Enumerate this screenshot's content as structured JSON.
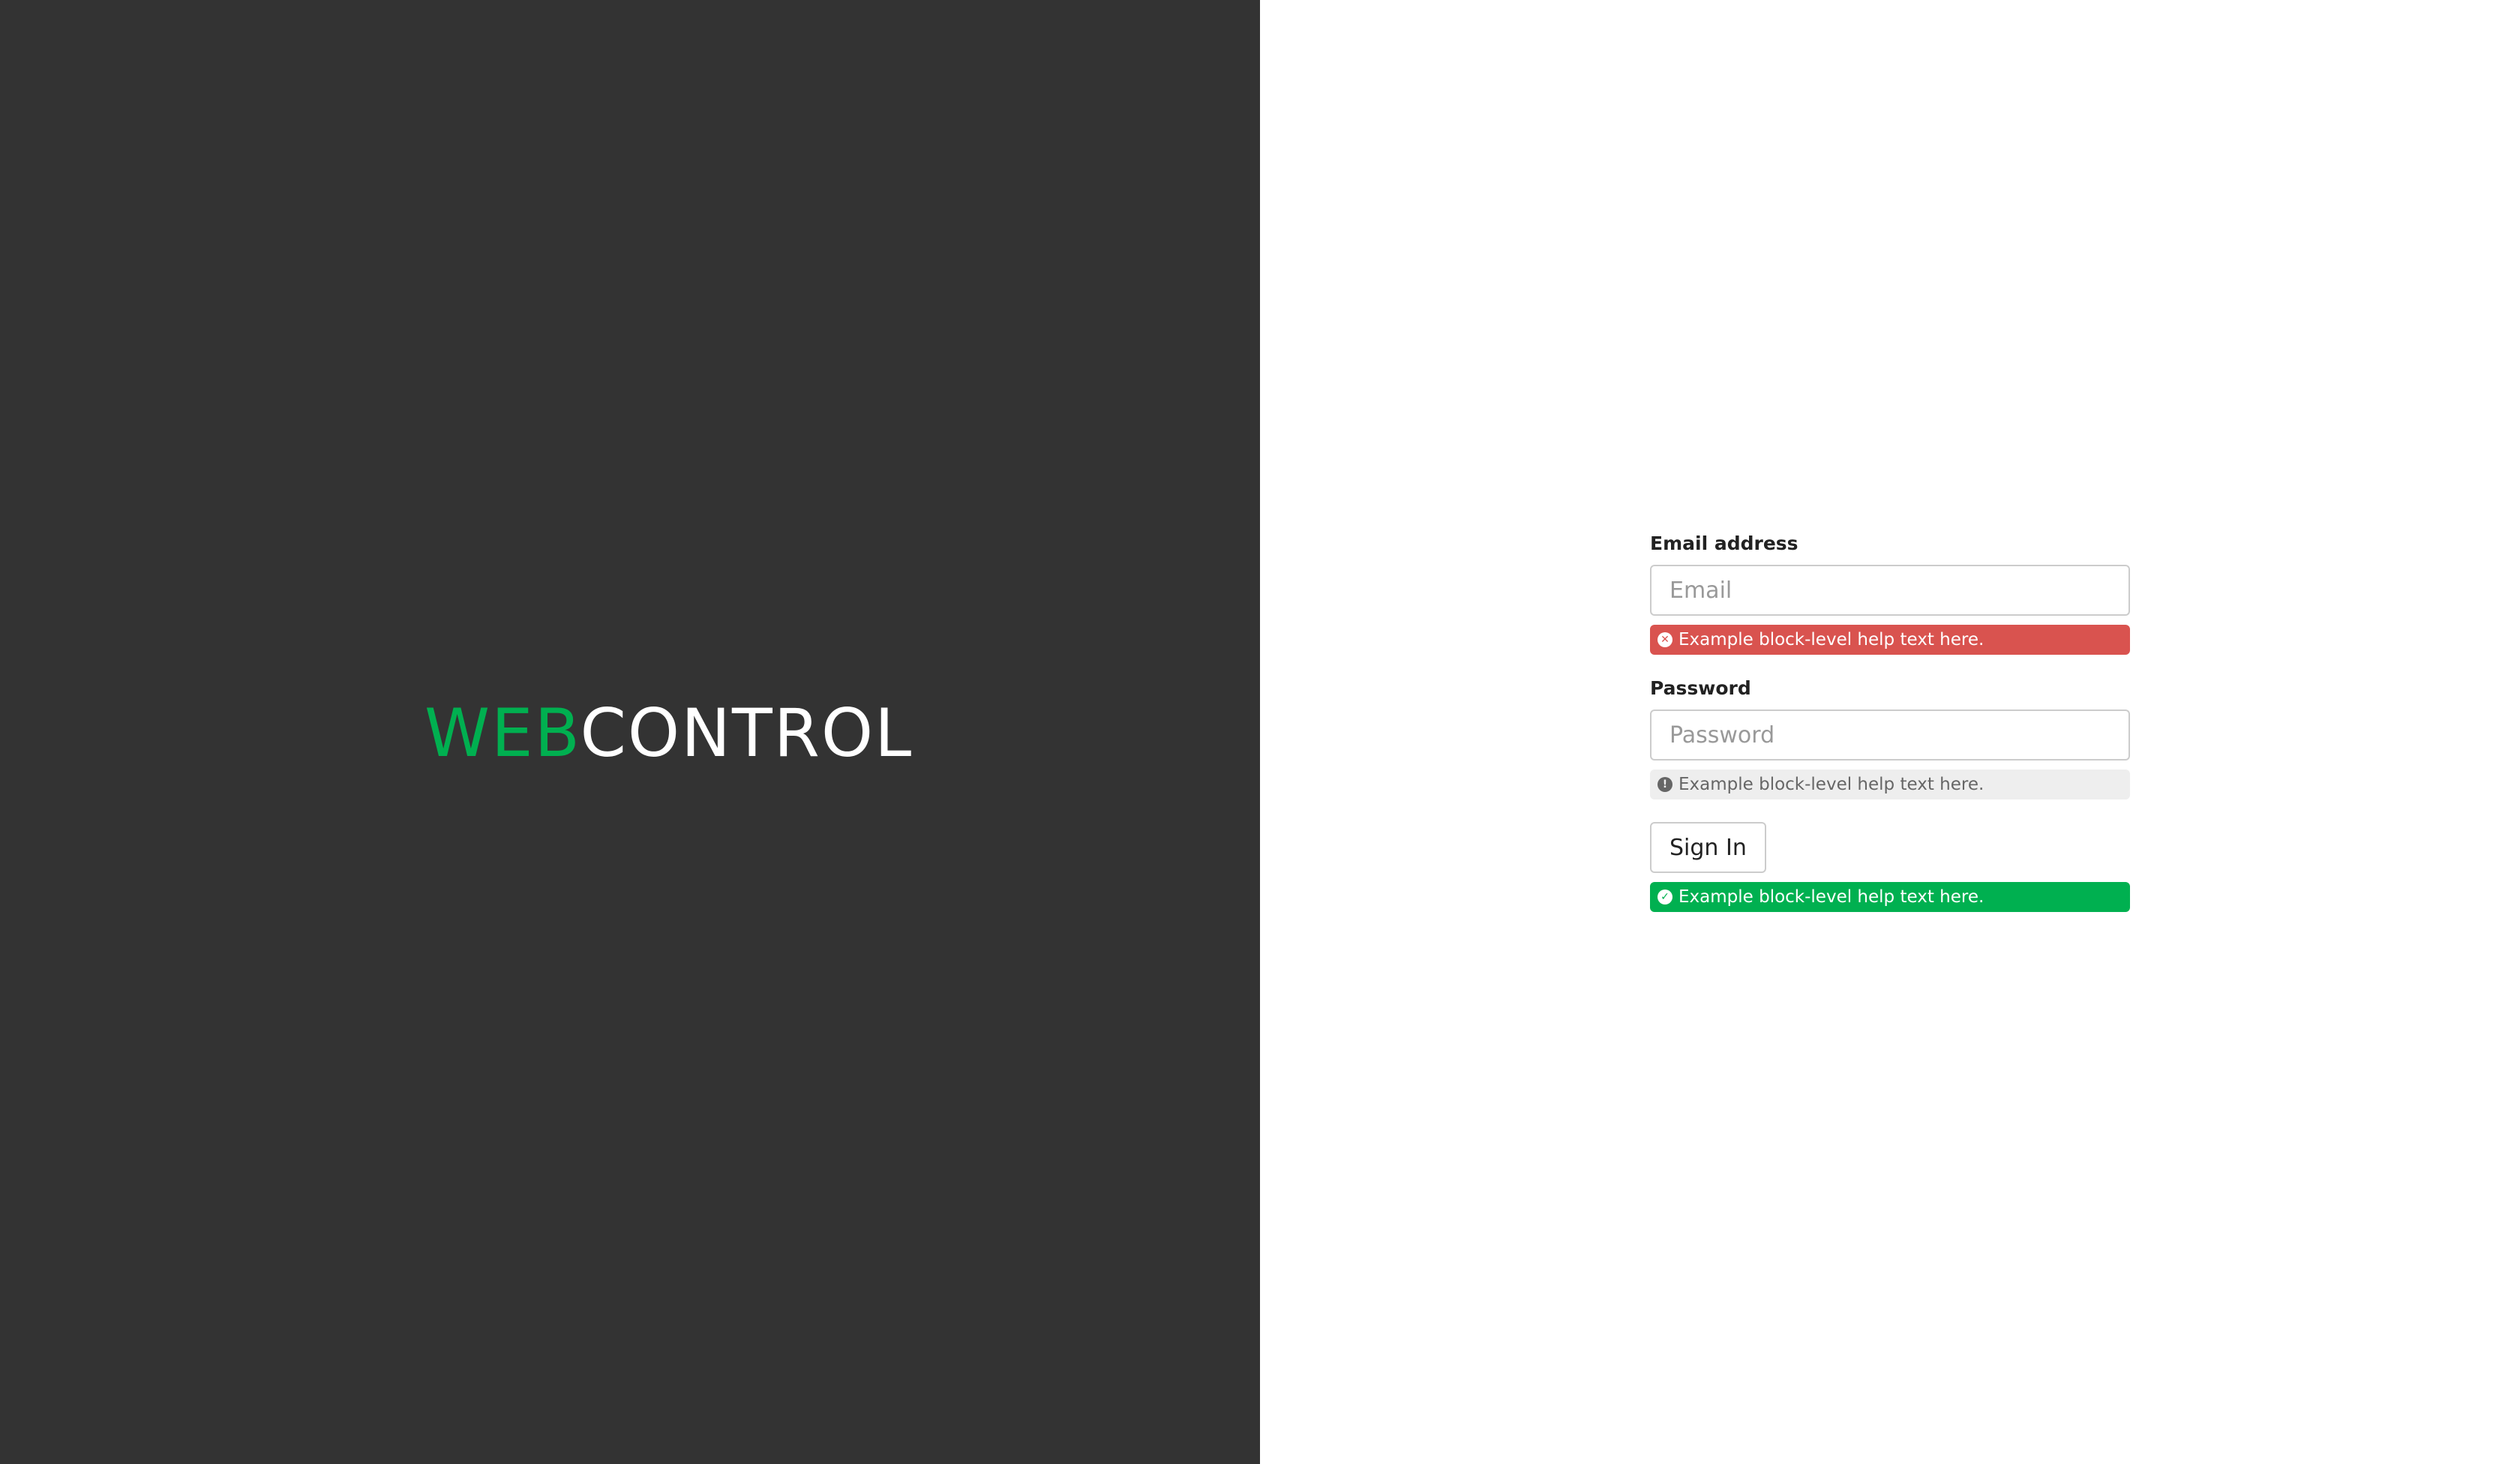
{
  "brand": {
    "logo_accent": "WEB",
    "logo_rest": "CONTROL",
    "accent_color": "#00b050",
    "panel_color": "#333333"
  },
  "form": {
    "email": {
      "label": "Email address",
      "placeholder": "Email",
      "value": "",
      "help_text": "Example block-level help text here.",
      "help_state": "error",
      "help_icon": "times-circle-icon"
    },
    "password": {
      "label": "Password",
      "placeholder": "Password",
      "value": "",
      "help_text": "Example block-level help text here.",
      "help_state": "info",
      "help_icon": "info-circle-icon"
    },
    "submit": {
      "label": "Sign In",
      "help_text": "Example block-level help text here.",
      "help_state": "success",
      "help_icon": "check-circle-icon"
    }
  },
  "colors": {
    "error": "#d9534f",
    "info_bg": "#eeeeee",
    "success": "#00b050"
  }
}
